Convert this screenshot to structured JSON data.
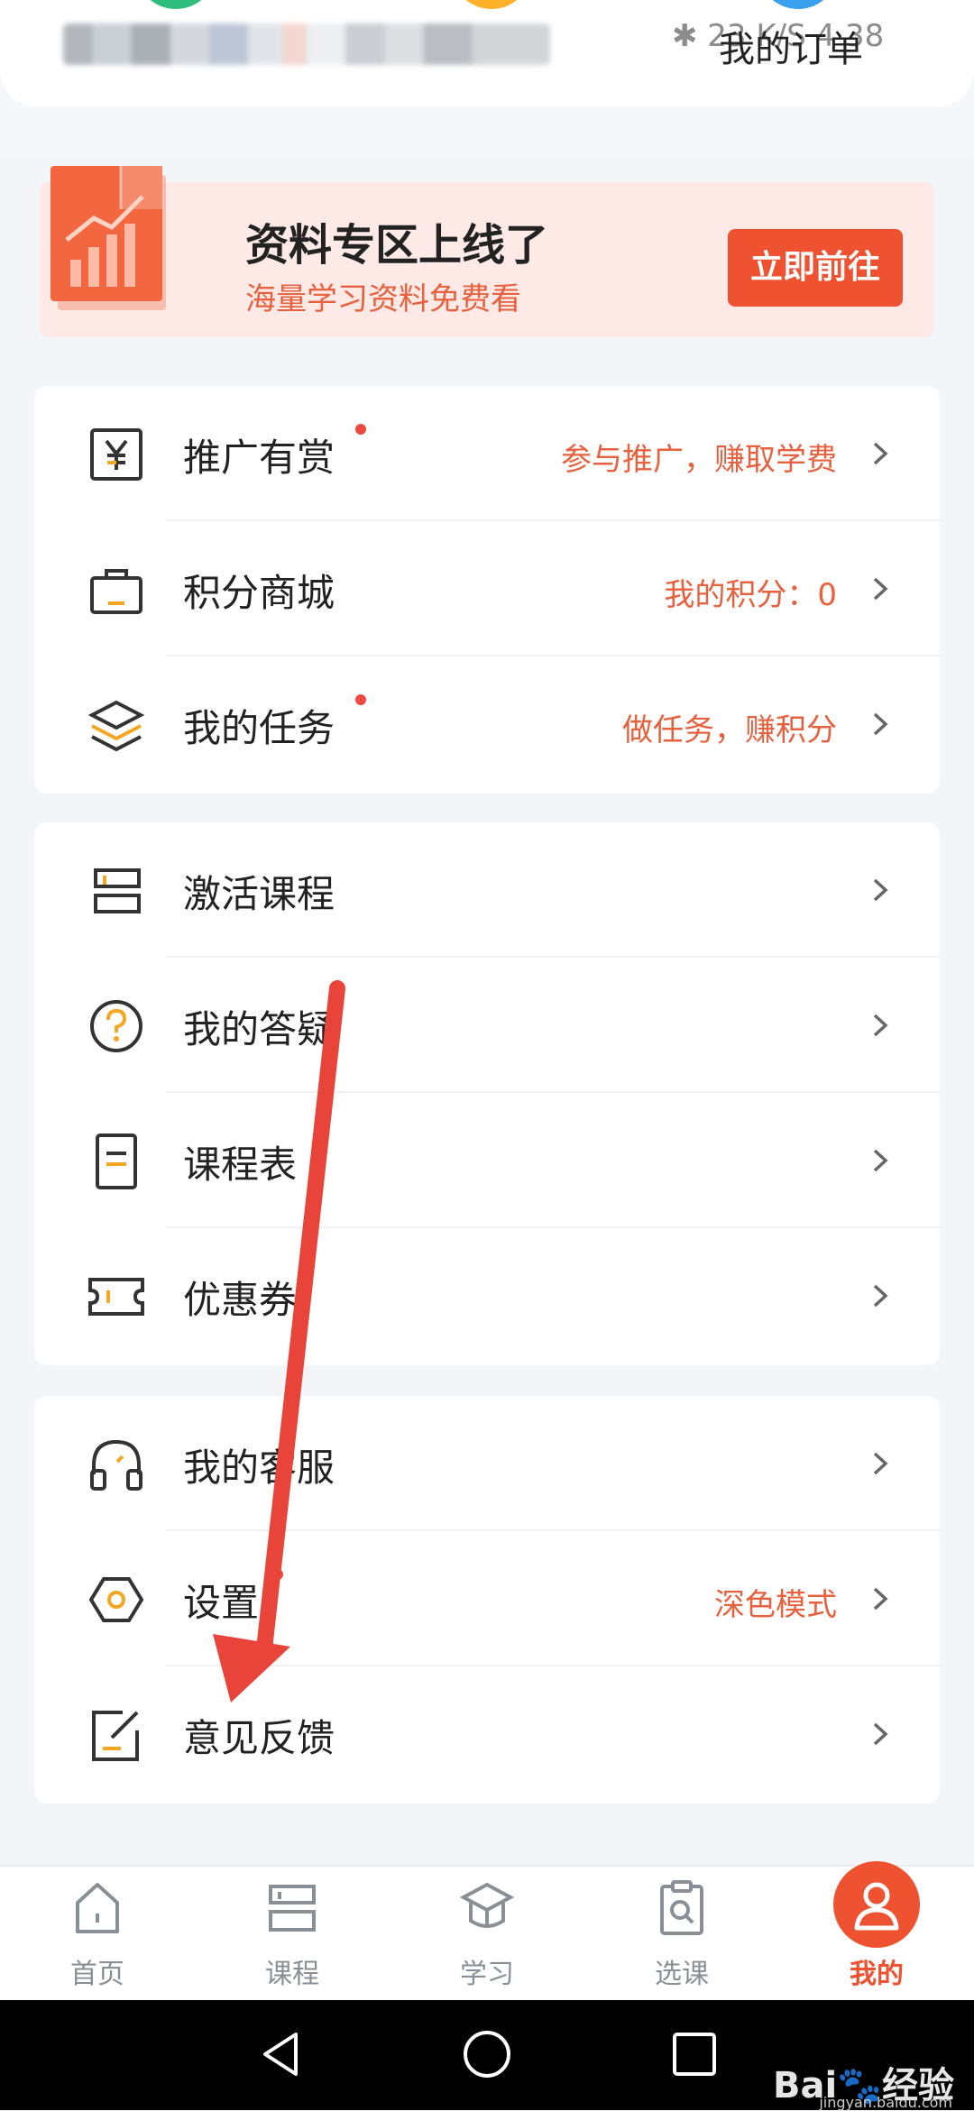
{
  "header": {
    "status_overlay": "✱ 23  K/S  4 38",
    "my_orders_label": "我的订单"
  },
  "banner": {
    "title": "资料专区上线了",
    "subtitle": "海量学习资料免费看",
    "button_label": "立即前往"
  },
  "menu": {
    "promote": {
      "label": "推广有赏",
      "hint": "参与推广，赚取学费",
      "has_dot": true
    },
    "points_mall": {
      "label": "积分商城",
      "hint": "我的积分：0",
      "has_dot": false
    },
    "my_tasks": {
      "label": "我的任务",
      "hint": "做任务，赚积分",
      "has_dot": true
    },
    "activate_course": {
      "label": "激活课程"
    },
    "my_qa": {
      "label": "我的答疑"
    },
    "schedule": {
      "label": "课程表"
    },
    "coupons": {
      "label": "优惠券"
    },
    "customer_service": {
      "label": "我的客服"
    },
    "settings": {
      "label": "设置",
      "hint": "深色模式",
      "has_dot": true
    },
    "feedback": {
      "label": "意见反馈"
    }
  },
  "tabs": [
    {
      "label": "首页",
      "icon": "home-icon"
    },
    {
      "label": "课程",
      "icon": "course-icon"
    },
    {
      "label": "学习",
      "icon": "graduation-cap-icon"
    },
    {
      "label": "选课",
      "icon": "clipboard-search-icon"
    },
    {
      "label": "我的",
      "icon": "user-icon",
      "active": true
    }
  ],
  "watermark": {
    "text": "Bai🐾经验",
    "sub": "jingyan.baidu.com"
  },
  "colors": {
    "accent": "#ee5231",
    "hint_text": "#e8613f",
    "icon_highlight": "#f5a623",
    "notification_dot": "#ef4a41",
    "banner_bg": "#fde9e6"
  }
}
